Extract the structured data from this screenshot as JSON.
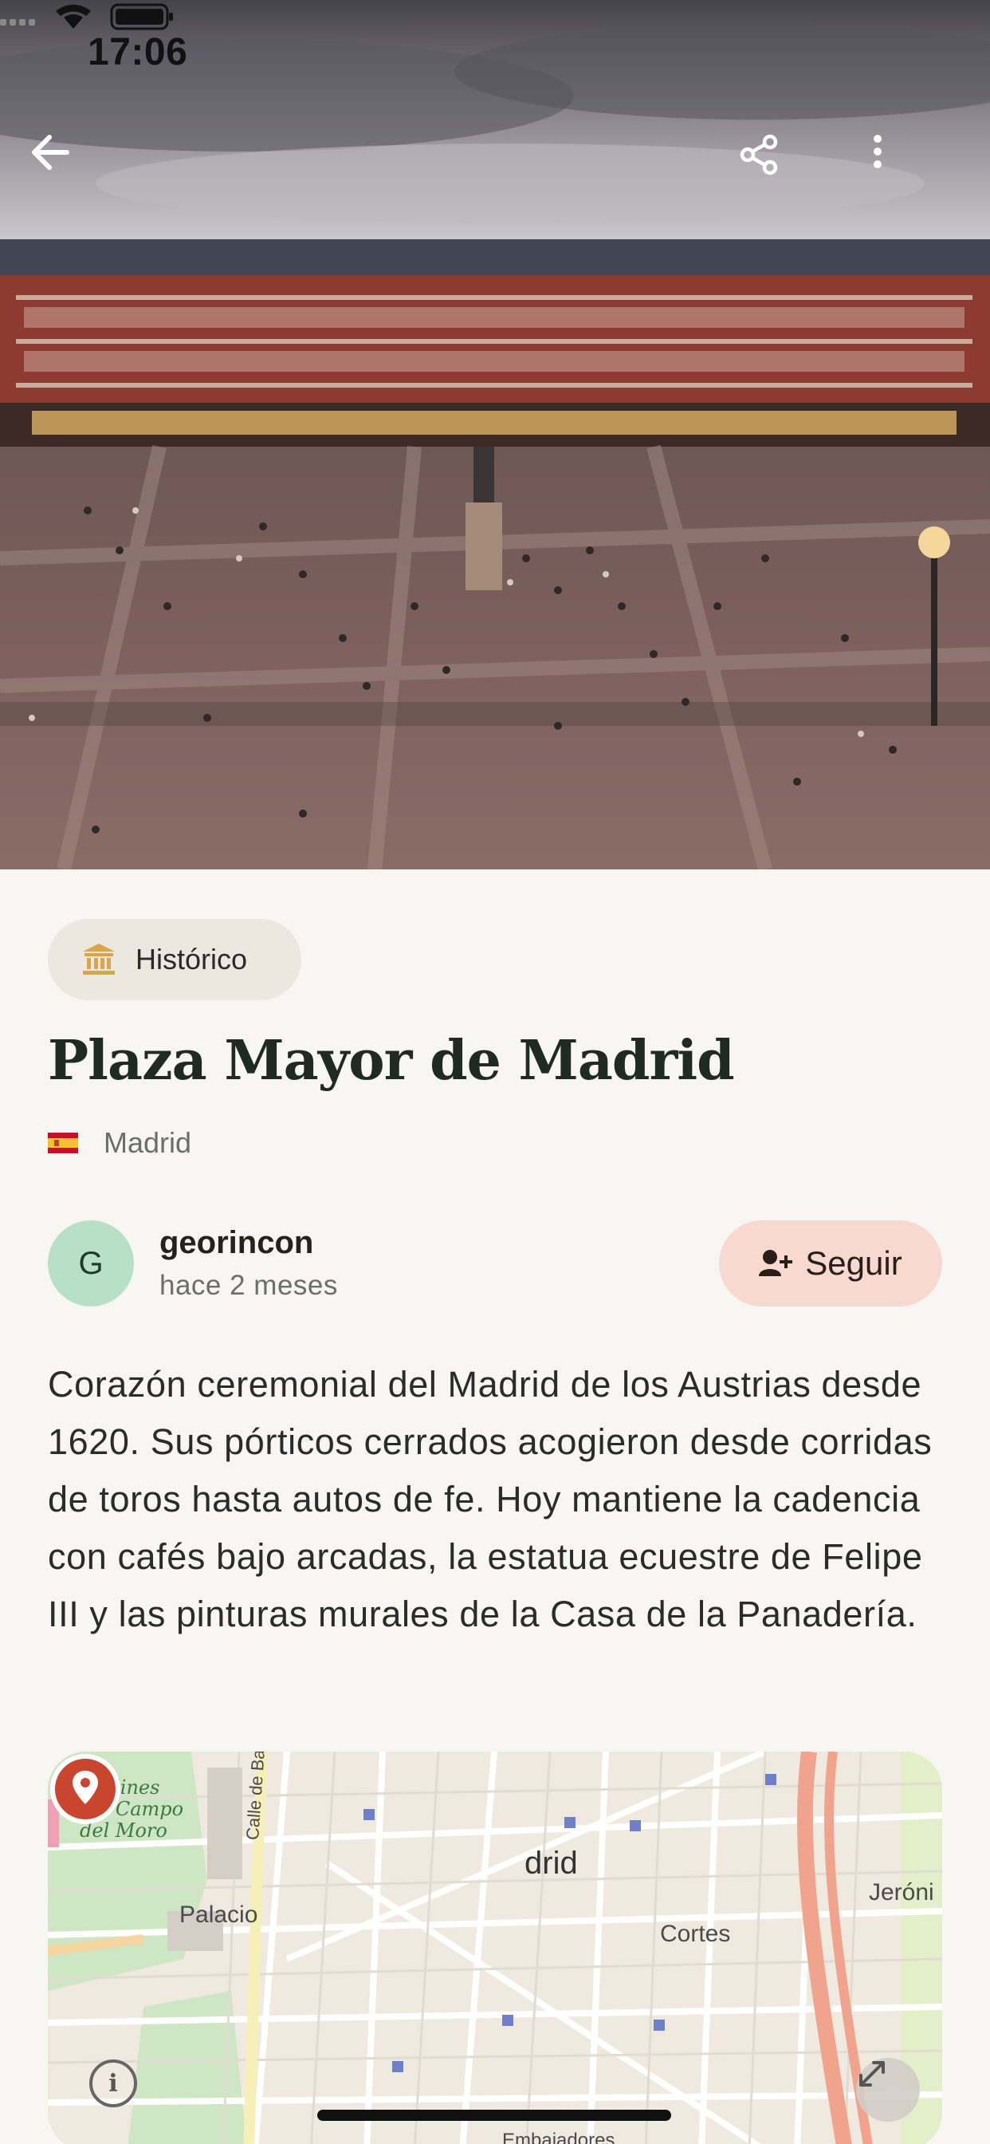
{
  "status_bar": {
    "time": "17:06"
  },
  "hero": {
    "image_alt": "Plaza Mayor de Madrid"
  },
  "category": {
    "label": "Histórico",
    "icon": "landmark-icon"
  },
  "place": {
    "title": "Plaza Mayor de Madrid",
    "location": "Madrid",
    "flag": "spain-flag"
  },
  "author": {
    "initial": "G",
    "username": "georincon",
    "posted": "hace 2 meses",
    "follow_label": "Seguir"
  },
  "description": "Corazón ceremonial del Madrid de los Austrias desde 1620. Sus pórticos cerrados acogieron desde corridas de toros hasta autos de fe. Hoy mantiene la cadencia con cafés bajo arcadas, la estatua ecuestre de Felipe III y las pinturas murales de la Casa de la Panadería.",
  "map": {
    "labels": {
      "park": "Jardines\ndel Campo\ndel Moro",
      "street": "Calle de Bail",
      "palace": "Palacio",
      "city": "Madrid",
      "city_visible": "drid",
      "cortes": "Cortes",
      "jeronimos": "Jeróni",
      "embajadores": "Embajadores",
      "pa": "Pa"
    },
    "info_symbol": "i"
  },
  "colors": {
    "background": "#f8f6f2",
    "chip_bg": "#ece8df",
    "follow_bg": "#f7d9d0",
    "avatar_bg": "#b8e0c6",
    "pin": "#c9452d",
    "title": "#1e2a22"
  }
}
